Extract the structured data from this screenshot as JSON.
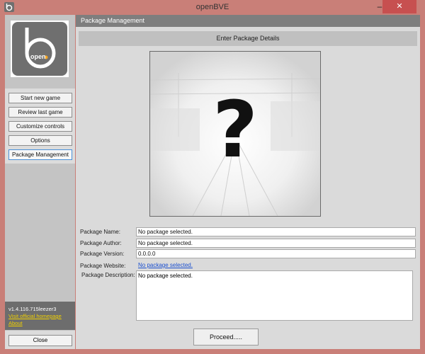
{
  "window": {
    "title": "openBVE",
    "minimize": "–",
    "maximize": "□",
    "close": "✕"
  },
  "sidebar": {
    "logo_text": "open",
    "buttons": [
      {
        "label": "Start new game"
      },
      {
        "label": "Review last game"
      },
      {
        "label": "Customize controls"
      },
      {
        "label": "Options"
      },
      {
        "label": "Package Management"
      }
    ],
    "version": "v1.4.116.715leezer3",
    "homepage_link": "Visit official homepage",
    "about_link": "About",
    "close_label": "Close"
  },
  "main": {
    "header": "Package Management",
    "section_title": "Enter Package Details",
    "image_placeholder": "?",
    "fields": {
      "name_label": "Package Name:",
      "name_value": "No package selected.",
      "author_label": "Package Author:",
      "author_value": "No package selected.",
      "version_label": "Package Version:",
      "version_value": "0.0.0.0",
      "website_label": "Package Website:",
      "website_value": "No package selected.",
      "description_label": "Package Description:",
      "description_value": "No package selected."
    },
    "proceed_label": "Proceed....."
  },
  "colors": {
    "frame": "#c97f78",
    "header": "#7e7e7e",
    "accent_link": "#1a4fd0",
    "version_link": "#f0d000"
  }
}
